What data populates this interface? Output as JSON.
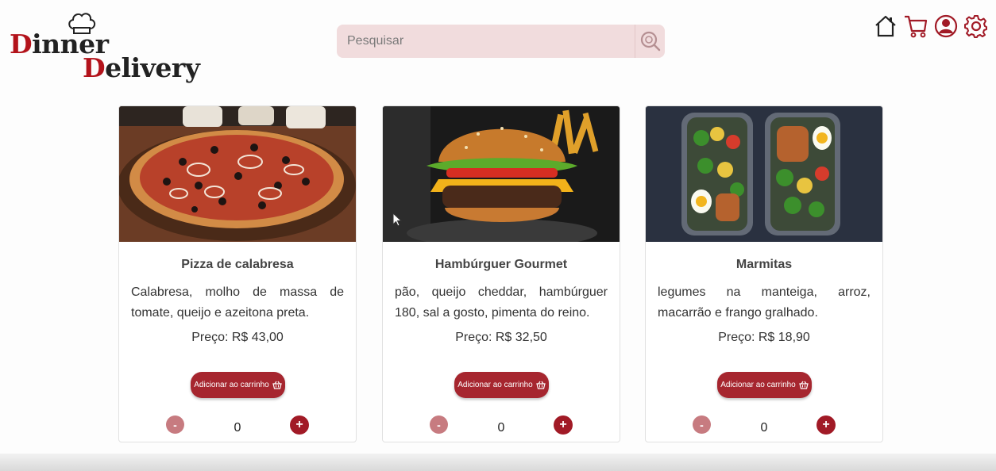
{
  "brand": {
    "line1_first": "D",
    "line1_rest": "inner",
    "line2_first": "D",
    "line2_rest": "elivery"
  },
  "search": {
    "placeholder": "Pesquisar",
    "value": ""
  },
  "nav": {
    "icons": [
      "home-icon",
      "cart-icon",
      "user-icon",
      "settings-icon"
    ]
  },
  "colors": {
    "accent": "#a6262f",
    "minus_button": "#c77b80",
    "search_bg": "#f1dcdd"
  },
  "products": [
    {
      "name": "Pizza de calabresa",
      "description": "Calabresa, molho de massa de tomate, queijo e azeitona preta.",
      "price": "Preço: R$ 43,00",
      "add_label": "Adicionar ao carrinho",
      "quantity": "0",
      "minus": "-",
      "plus": "+"
    },
    {
      "name": "Hambúrguer Gourmet",
      "description": "pão, queijo cheddar, hambúrguer 180, sal a gosto, pimenta do reino.",
      "price": "Preço: R$ 32,50",
      "add_label": "Adicionar ao carrinho",
      "quantity": "0",
      "minus": "-",
      "plus": "+"
    },
    {
      "name": "Marmitas",
      "description": "legumes na manteiga, arroz, macarrão e frango gralhado.",
      "price": "Preço: R$ 18,90",
      "add_label": "Adicionar ao carrinho",
      "quantity": "0",
      "minus": "-",
      "plus": "+"
    }
  ]
}
